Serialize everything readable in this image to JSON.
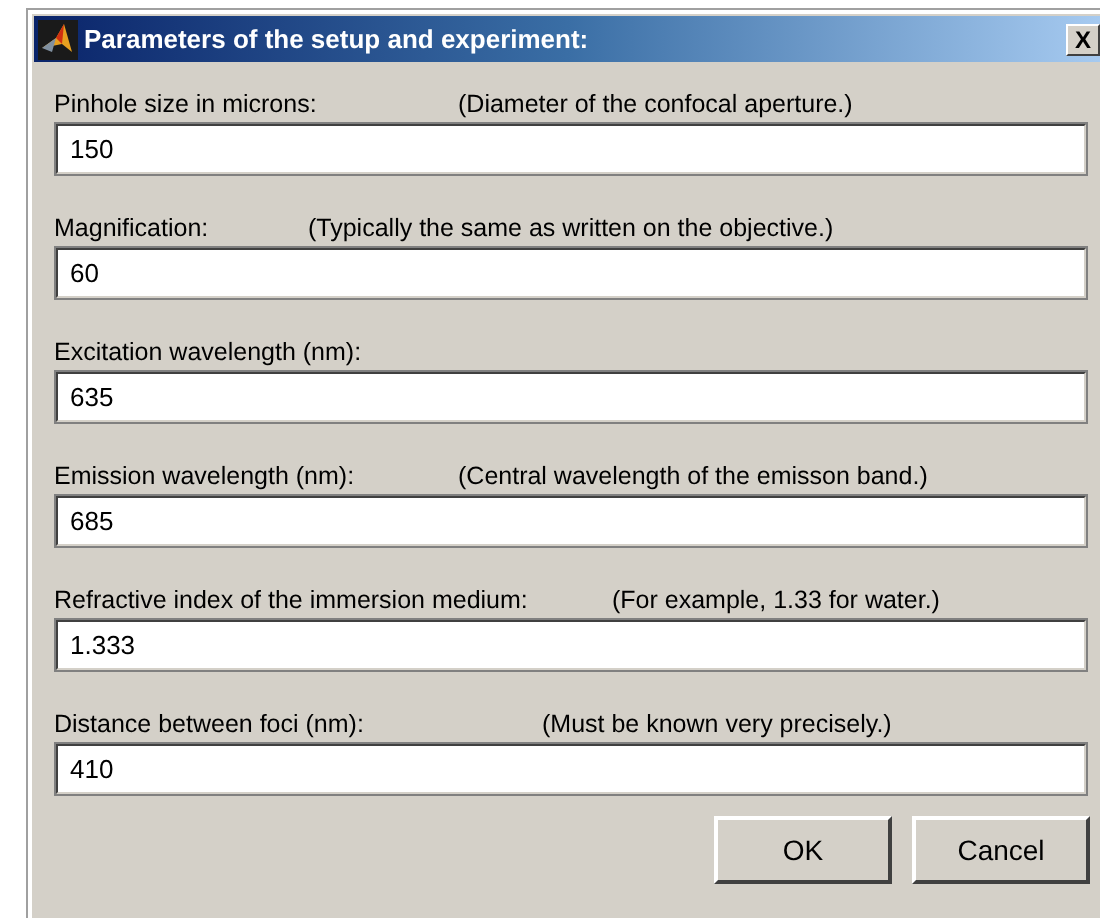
{
  "window": {
    "title": "Parameters of the setup and experiment:",
    "close": "X"
  },
  "fields": [
    {
      "label": "Pinhole size in microns:",
      "hint": "(Diameter of the confocal aperture.)",
      "value": "150"
    },
    {
      "label": "Magnification:",
      "hint": "(Typically the same as written on the objective.)",
      "value": "60"
    },
    {
      "label": "Excitation wavelength (nm):",
      "value": "635"
    },
    {
      "label": "Emission wavelength (nm):",
      "hint": "(Central wavelength of the emisson band.)",
      "value": "685"
    },
    {
      "label": "Refractive index of the immersion medium:",
      "hint": "(For example, 1.33 for water.)",
      "value": "1.333"
    },
    {
      "label": "Distance between foci (nm):",
      "hint": "(Must be known very precisely.)",
      "value": "410"
    }
  ],
  "buttons": [
    "OK",
    "Cancel"
  ]
}
